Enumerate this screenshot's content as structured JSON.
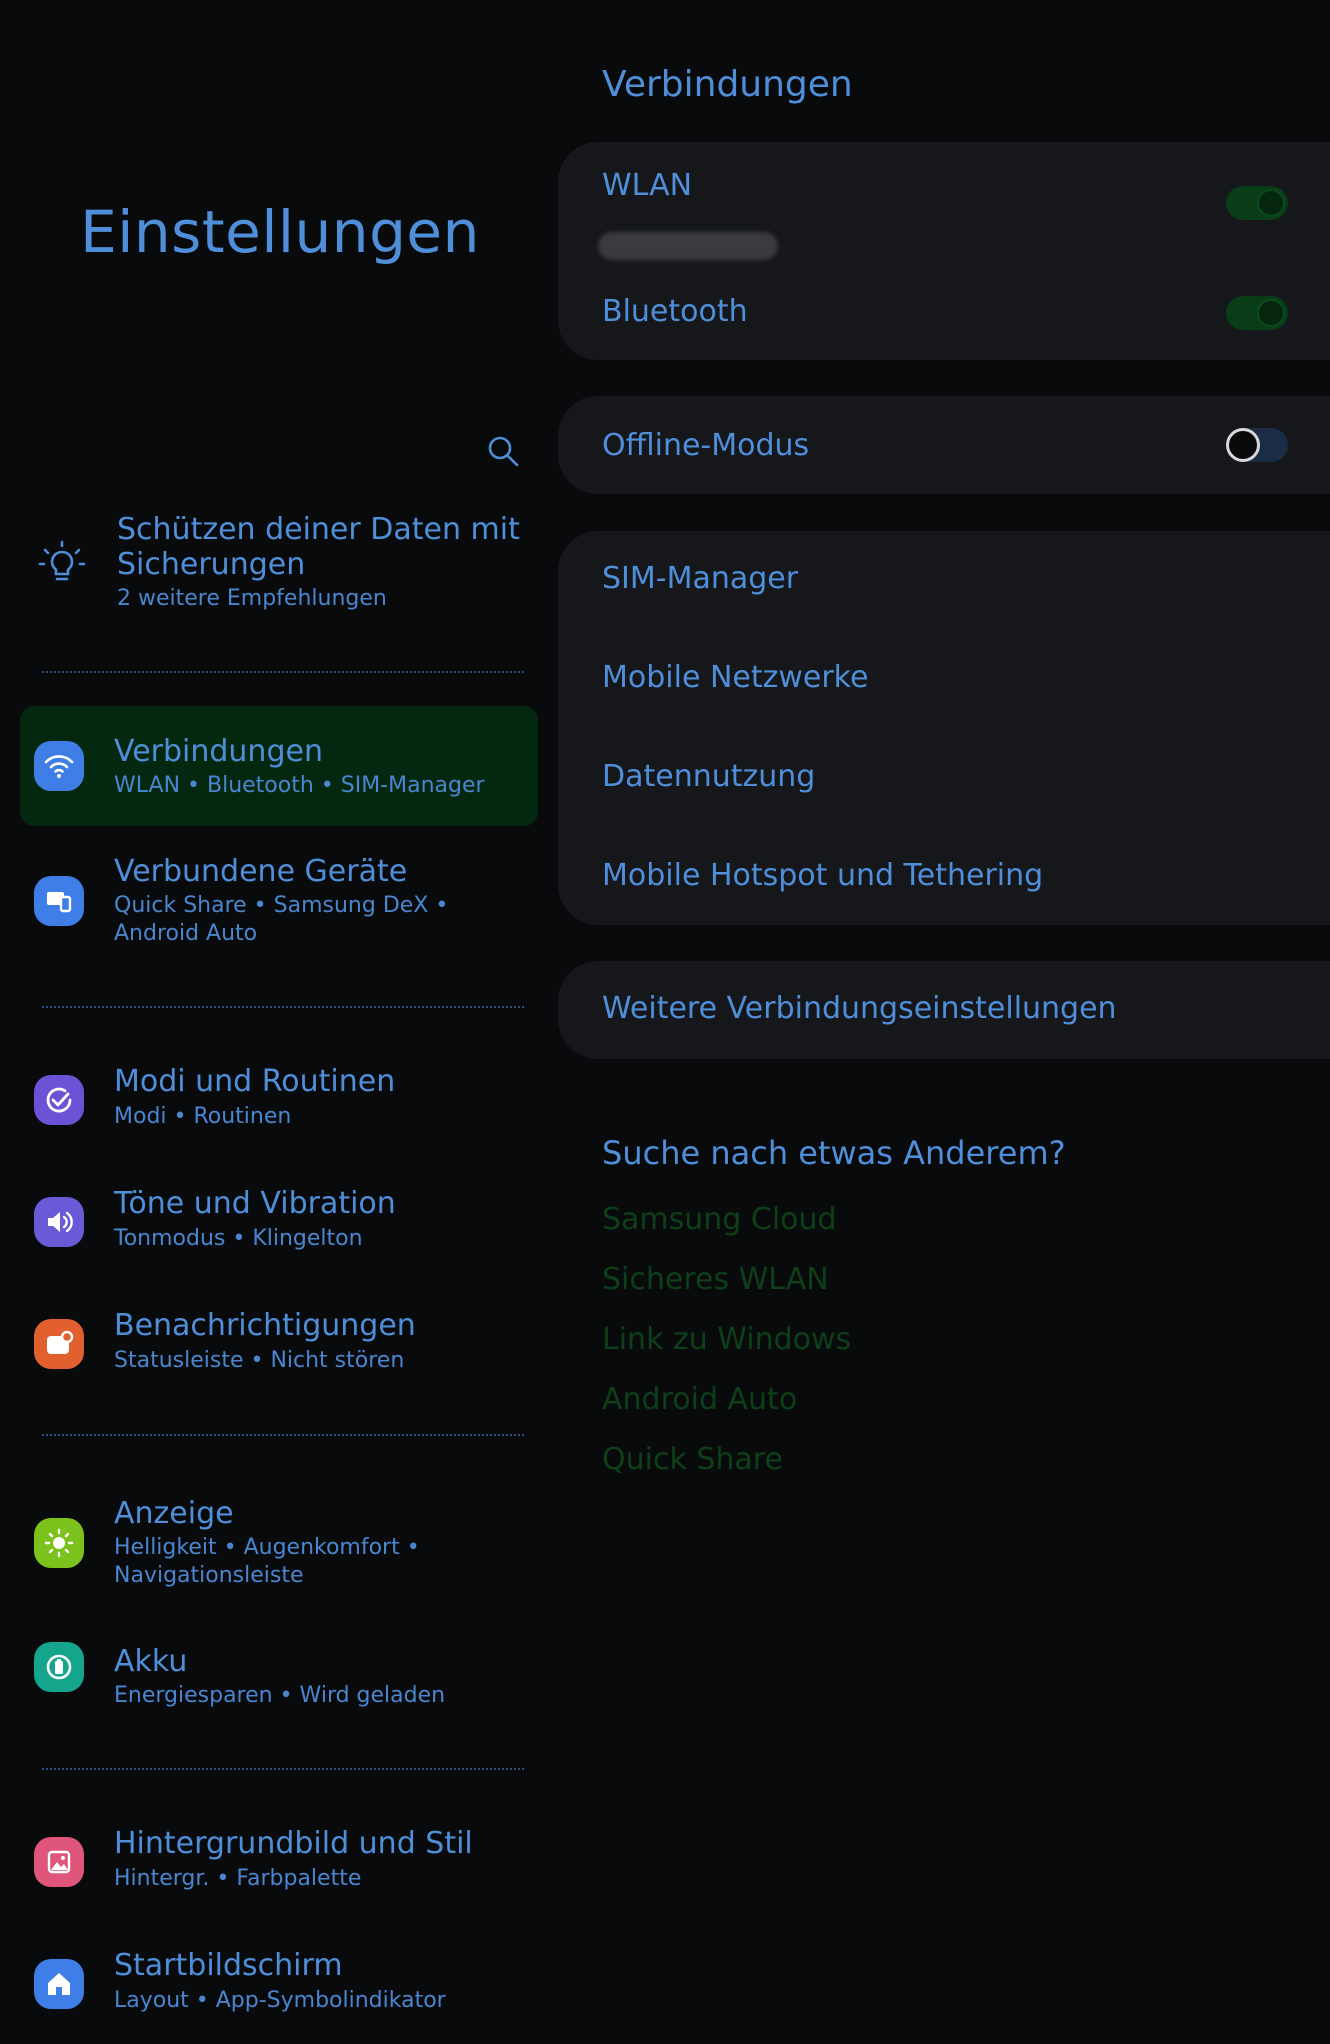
{
  "left": {
    "title": "Einstellungen",
    "search_icon": "search-icon",
    "suggestion": {
      "icon": "lightbulb-icon",
      "title": "Schützen deiner Daten mit Sicherungen",
      "subtitle": "2 weitere Empfehlungen"
    },
    "items": [
      {
        "title": "Verbindungen",
        "subtitle": "WLAN  •  Bluetooth  •  SIM-Manager",
        "icon": "wifi-icon",
        "color": "#3e7ee6",
        "active": true
      },
      {
        "title": "Verbundene Geräte",
        "subtitle": "Quick Share  •  Samsung DeX  •  Android Auto",
        "icon": "devices-icon",
        "color": "#3e7ee6"
      },
      {
        "title": "Modi und Routinen",
        "subtitle": "Modi  •  Routinen",
        "icon": "routine-check-icon",
        "color": "#6b52d6"
      },
      {
        "title": "Töne und Vibration",
        "subtitle": "Tonmodus  •  Klingelton",
        "icon": "speaker-icon",
        "color": "#6a5ad8"
      },
      {
        "title": "Benachrichtigungen",
        "subtitle": "Statusleiste  •  Nicht stören",
        "icon": "notification-icon",
        "color": "#e2602e"
      },
      {
        "title": "Anzeige",
        "subtitle": "Helligkeit  •  Augenkomfort  •  Navigationsleiste",
        "icon": "sun-icon",
        "color": "#7cc21c"
      },
      {
        "title": "Akku",
        "subtitle": "Energiesparen  •  Wird geladen",
        "icon": "battery-icon",
        "color": "#14a58c"
      },
      {
        "title": "Hintergrundbild und Stil",
        "subtitle": "Hintergr.  •  Farbpalette",
        "icon": "wallpaper-icon",
        "color": "#e0557a"
      },
      {
        "title": "Startbildschirm",
        "subtitle": "Layout  •  App-Symbolindikator",
        "icon": "home-icon",
        "color": "#3e7ee6"
      }
    ]
  },
  "right": {
    "section_title": "Verbindungen",
    "wlan": {
      "label": "WLAN",
      "enabled": true
    },
    "bluetooth": {
      "label": "Bluetooth",
      "enabled": true
    },
    "offline": {
      "label": "Offline-Modus",
      "enabled": false
    },
    "group": [
      "SIM-Manager",
      "Mobile Netzwerke",
      "Datennutzung",
      "Mobile Hotspot und Tethering"
    ],
    "more": "Weitere Verbindungseinstellungen",
    "looking_for": {
      "title": "Suche nach etwas Anderem?",
      "links": [
        "Samsung Cloud",
        "Sicheres WLAN",
        "Link zu Windows",
        "Android Auto",
        "Quick Share"
      ]
    }
  },
  "colors": {
    "accent_text": "#4f8ed9",
    "active_bg": "#04280f",
    "link_green": "#0d3f19",
    "background": "#090a0c",
    "card": "#15171b"
  }
}
